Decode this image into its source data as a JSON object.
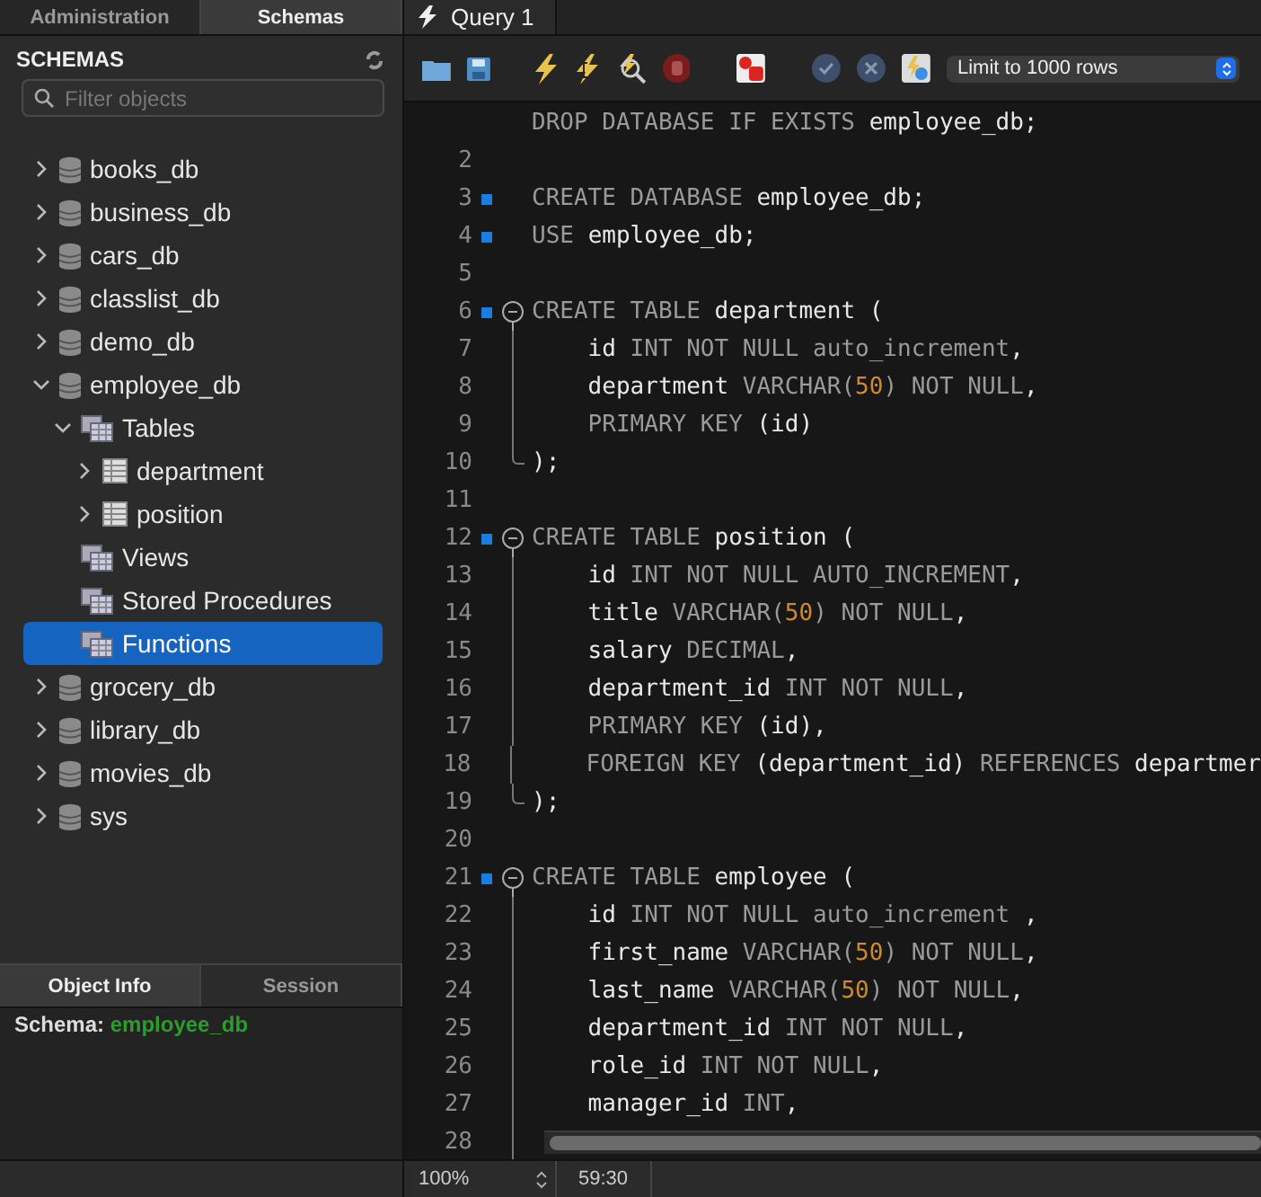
{
  "top_tabs": [
    {
      "label": "Administration",
      "selected": false
    },
    {
      "label": "Schemas",
      "selected": true
    }
  ],
  "query_tab": {
    "label": "Query 1"
  },
  "schemas": {
    "title": "SCHEMAS",
    "filter": {
      "placeholder": "Filter objects"
    },
    "tree": [
      {
        "label": "books_db",
        "kind": "schema",
        "expanded": false,
        "selected": false
      },
      {
        "label": "business_db",
        "kind": "schema",
        "expanded": false,
        "selected": false
      },
      {
        "label": "cars_db",
        "kind": "schema",
        "expanded": false,
        "selected": false
      },
      {
        "label": "classlist_db",
        "kind": "schema",
        "expanded": false,
        "selected": false
      },
      {
        "label": "demo_db",
        "kind": "schema",
        "expanded": false,
        "selected": false
      },
      {
        "label": "employee_db",
        "kind": "schema",
        "expanded": true,
        "selected": false,
        "children": [
          {
            "label": "Tables",
            "kind": "folder",
            "expanded": true,
            "selected": false,
            "children": [
              {
                "label": "department",
                "kind": "table",
                "expanded": false,
                "selected": false
              },
              {
                "label": "position",
                "kind": "table",
                "expanded": false,
                "selected": false
              }
            ]
          },
          {
            "label": "Views",
            "kind": "folder",
            "selected": false
          },
          {
            "label": "Stored Procedures",
            "kind": "folder",
            "selected": false
          },
          {
            "label": "Functions",
            "kind": "folder",
            "selected": true
          }
        ]
      },
      {
        "label": "grocery_db",
        "kind": "schema",
        "expanded": false,
        "selected": false
      },
      {
        "label": "library_db",
        "kind": "schema",
        "expanded": false,
        "selected": false
      },
      {
        "label": "movies_db",
        "kind": "schema",
        "expanded": false,
        "selected": false
      },
      {
        "label": "sys",
        "kind": "schema",
        "expanded": false,
        "selected": false
      }
    ]
  },
  "info_tabs": [
    {
      "label": "Object Info",
      "selected": true
    },
    {
      "label": "Session",
      "selected": false
    }
  ],
  "object_info": {
    "label": "Schema:",
    "value": "employee_db"
  },
  "toolbar": {
    "limit": "Limit to 1000 rows"
  },
  "editor": {
    "lines": [
      {
        "kind": "plain",
        "dot": false,
        "tokens": [
          {
            "kind": "keyword",
            "text": "DROP DATABASE IF EXISTS "
          },
          {
            "kind": "name",
            "text": "employee_db;"
          }
        ]
      },
      {
        "kind": "plain",
        "number": "2",
        "dot": false
      },
      {
        "kind": "plain",
        "number": "3",
        "dot": true,
        "tokens": [
          {
            "kind": "keyword",
            "text": "CREATE DATABASE "
          },
          {
            "kind": "name",
            "text": "employee_db;"
          }
        ]
      },
      {
        "kind": "plain",
        "number": "4",
        "dot": true,
        "tokens": [
          {
            "kind": "keyword",
            "text": "USE "
          },
          {
            "kind": "name",
            "text": "employee_db;"
          }
        ]
      },
      {
        "kind": "plain",
        "number": "5",
        "dot": false
      },
      {
        "kind": "block_start",
        "number": "6",
        "dot": true,
        "tokens": [
          {
            "kind": "keyword",
            "text": "CREATE TABLE "
          },
          {
            "kind": "name",
            "text": "department ("
          }
        ]
      },
      {
        "kind": "block_body",
        "number": "7",
        "dot": false,
        "tokens": [
          {
            "kind": "name",
            "text": "    id "
          },
          {
            "kind": "keyword",
            "text": "INT NOT NULL auto_increment"
          },
          {
            "kind": "name",
            "text": ","
          }
        ]
      },
      {
        "kind": "block_body",
        "number": "8",
        "dot": false,
        "tokens": [
          {
            "kind": "name",
            "text": "    department "
          },
          {
            "kind": "keyword",
            "text": "VARCHAR("
          },
          {
            "kind": "number",
            "text": "50"
          },
          {
            "kind": "keyword",
            "text": ") NOT NULL"
          },
          {
            "kind": "name",
            "text": ","
          }
        ]
      },
      {
        "kind": "block_body",
        "number": "9",
        "dot": false,
        "tokens": [
          {
            "kind": "keyword",
            "text": "    PRIMARY KEY "
          },
          {
            "kind": "name",
            "text": "(id)"
          }
        ]
      },
      {
        "kind": "block_end",
        "number": "10",
        "dot": false,
        "tokens": [
          {
            "kind": "name",
            "text": ");"
          }
        ]
      },
      {
        "kind": "plain",
        "number": "11",
        "dot": false
      },
      {
        "kind": "block_start",
        "number": "12",
        "dot": true,
        "tokens": [
          {
            "kind": "keyword",
            "text": "CREATE TABLE "
          },
          {
            "kind": "name",
            "text": "position ("
          }
        ]
      },
      {
        "kind": "block_body",
        "number": "13",
        "dot": false,
        "tokens": [
          {
            "kind": "name",
            "text": "    id "
          },
          {
            "kind": "keyword",
            "text": "INT NOT NULL AUTO_INCREMENT"
          },
          {
            "kind": "name",
            "text": ","
          }
        ]
      },
      {
        "kind": "block_body",
        "number": "14",
        "dot": false,
        "tokens": [
          {
            "kind": "name",
            "text": "    title "
          },
          {
            "kind": "keyword",
            "text": "VARCHAR("
          },
          {
            "kind": "number",
            "text": "50"
          },
          {
            "kind": "keyword",
            "text": ") NOT NULL"
          },
          {
            "kind": "name",
            "text": ","
          }
        ]
      },
      {
        "kind": "block_body",
        "number": "15",
        "dot": false,
        "tokens": [
          {
            "kind": "name",
            "text": "    salary "
          },
          {
            "kind": "keyword",
            "text": "DECIMAL"
          },
          {
            "kind": "name",
            "text": ","
          }
        ]
      },
      {
        "kind": "block_body",
        "number": "16",
        "dot": false,
        "tokens": [
          {
            "kind": "name",
            "text": "    department_id "
          },
          {
            "kind": "keyword",
            "text": "INT NOT NULL"
          },
          {
            "kind": "name",
            "text": ","
          }
        ]
      },
      {
        "kind": "block_body",
        "number": "17",
        "dot": false,
        "tokens": [
          {
            "kind": "keyword",
            "text": "    PRIMARY KEY "
          },
          {
            "kind": "name",
            "text": "(id),"
          }
        ]
      },
      {
        "kind": "block_body",
        "number": "18",
        "dot": false,
        "tokens": [
          {
            "kind": "keyword",
            "text": "    FOREIGN KEY "
          },
          {
            "kind": "name",
            "text": "(department_id) "
          },
          {
            "kind": "keyword",
            "text": "REFERENCES "
          },
          {
            "kind": "name",
            "text": "departmer"
          }
        ]
      },
      {
        "kind": "block_end",
        "number": "19",
        "dot": false,
        "tokens": [
          {
            "kind": "name",
            "text": ");"
          }
        ]
      },
      {
        "kind": "plain",
        "number": "20",
        "dot": false
      },
      {
        "kind": "block_start",
        "number": "21",
        "dot": true,
        "tokens": [
          {
            "kind": "keyword",
            "text": "CREATE TABLE "
          },
          {
            "kind": "name",
            "text": "employee ("
          }
        ]
      },
      {
        "kind": "block_body",
        "number": "22",
        "dot": false,
        "tokens": [
          {
            "kind": "name",
            "text": "    id "
          },
          {
            "kind": "keyword",
            "text": "INT NOT NULL auto_increment "
          },
          {
            "kind": "name",
            "text": ","
          }
        ]
      },
      {
        "kind": "block_body",
        "number": "23",
        "dot": false,
        "tokens": [
          {
            "kind": "name",
            "text": "    first_name "
          },
          {
            "kind": "keyword",
            "text": "VARCHAR("
          },
          {
            "kind": "number",
            "text": "50"
          },
          {
            "kind": "keyword",
            "text": ") NOT NULL"
          },
          {
            "kind": "name",
            "text": ","
          }
        ]
      },
      {
        "kind": "block_body",
        "number": "24",
        "dot": false,
        "tokens": [
          {
            "kind": "name",
            "text": "    last_name "
          },
          {
            "kind": "keyword",
            "text": "VARCHAR("
          },
          {
            "kind": "number",
            "text": "50"
          },
          {
            "kind": "keyword",
            "text": ") NOT NULL"
          },
          {
            "kind": "name",
            "text": ","
          }
        ]
      },
      {
        "kind": "block_body",
        "number": "25",
        "dot": false,
        "tokens": [
          {
            "kind": "name",
            "text": "    department_id "
          },
          {
            "kind": "keyword",
            "text": "INT NOT NULL"
          },
          {
            "kind": "name",
            "text": ","
          }
        ]
      },
      {
        "kind": "block_body",
        "number": "26",
        "dot": false,
        "tokens": [
          {
            "kind": "name",
            "text": "    role_id "
          },
          {
            "kind": "keyword",
            "text": "INT NOT NULL"
          },
          {
            "kind": "name",
            "text": ","
          }
        ]
      },
      {
        "kind": "block_body",
        "number": "27",
        "dot": false,
        "tokens": [
          {
            "kind": "name",
            "text": "    manager_id "
          },
          {
            "kind": "keyword",
            "text": "INT"
          },
          {
            "kind": "name",
            "text": ","
          }
        ]
      },
      {
        "kind": "block_body",
        "number": "28",
        "dot": false
      }
    ]
  },
  "status": {
    "zoom": "100%",
    "position": "59:30"
  }
}
